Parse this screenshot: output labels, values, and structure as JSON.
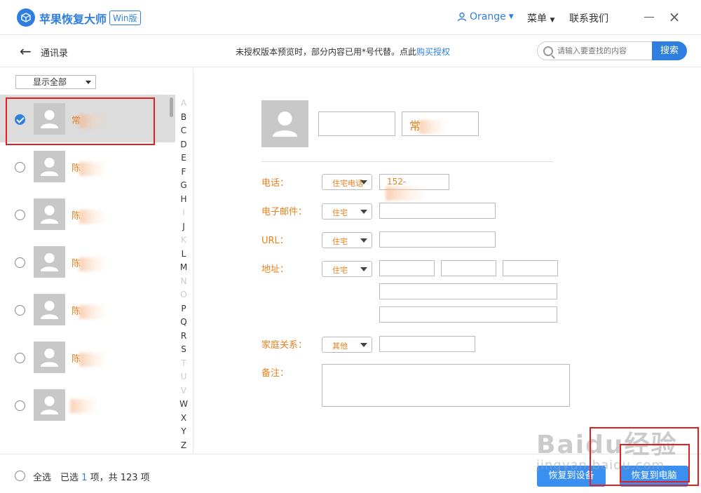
{
  "app": {
    "title": "苹果恢复大师",
    "edition_badge": "Win版"
  },
  "header": {
    "user_name": "Orange",
    "menu_label": "菜单",
    "contact_label": "联系我们",
    "close_glyph": "×"
  },
  "toolbar": {
    "back_glyph": "←",
    "section_title": "通讯录",
    "notice_text": "未授权版本预览时，部分内容已用*号代替。点此",
    "buy_link": "购买授权",
    "search_placeholder": "请输入要查找的内容",
    "search_button": "搜索"
  },
  "filter": {
    "selected": "显示全部"
  },
  "contacts": [
    {
      "name": "常",
      "selected": true
    },
    {
      "name": "陈",
      "selected": false
    },
    {
      "name": "陈",
      "selected": false
    },
    {
      "name": "陈",
      "selected": false
    },
    {
      "name": "陈",
      "selected": false
    },
    {
      "name": "陈",
      "selected": false
    },
    {
      "name": "",
      "selected": false
    }
  ],
  "alphabet": [
    {
      "l": "A",
      "on": false
    },
    {
      "l": "B",
      "on": true
    },
    {
      "l": "C",
      "on": true
    },
    {
      "l": "D",
      "on": true
    },
    {
      "l": "E",
      "on": true
    },
    {
      "l": "F",
      "on": true
    },
    {
      "l": "G",
      "on": true
    },
    {
      "l": "H",
      "on": true
    },
    {
      "l": "I",
      "on": false
    },
    {
      "l": "J",
      "on": true
    },
    {
      "l": "K",
      "on": false
    },
    {
      "l": "L",
      "on": true
    },
    {
      "l": "M",
      "on": true
    },
    {
      "l": "N",
      "on": false
    },
    {
      "l": "O",
      "on": false
    },
    {
      "l": "P",
      "on": true
    },
    {
      "l": "Q",
      "on": true
    },
    {
      "l": "R",
      "on": true
    },
    {
      "l": "S",
      "on": true
    },
    {
      "l": "T",
      "on": false
    },
    {
      "l": "U",
      "on": false
    },
    {
      "l": "V",
      "on": false
    },
    {
      "l": "W",
      "on": true
    },
    {
      "l": "X",
      "on": true
    },
    {
      "l": "Y",
      "on": true
    },
    {
      "l": "Z",
      "on": true
    }
  ],
  "detail": {
    "last_name": "常",
    "phone_label": "电话：",
    "phone_type": "住宅电话",
    "phone_value": "152-",
    "email_label": "电子邮件：",
    "email_type": "住宅",
    "url_label": "URL：",
    "url_type": "住宅",
    "address_label": "地址：",
    "address_type": "住宅",
    "family_label": "家庭关系：",
    "family_type": "其他",
    "notes_label": "备注："
  },
  "footer": {
    "select_all": "全选",
    "selected_prefix": "已选",
    "selected_count": "1",
    "selected_suffix": "项，共 123 项",
    "restore_device": "恢复到设备",
    "restore_pc": "恢复到电脑"
  },
  "watermark": {
    "main": "Baidu经验",
    "sub": "jingyan.baidu.com"
  },
  "colors": {
    "accent": "#2f7fe0",
    "orange_text": "#e8801c",
    "highlight_red": "#e02020"
  }
}
